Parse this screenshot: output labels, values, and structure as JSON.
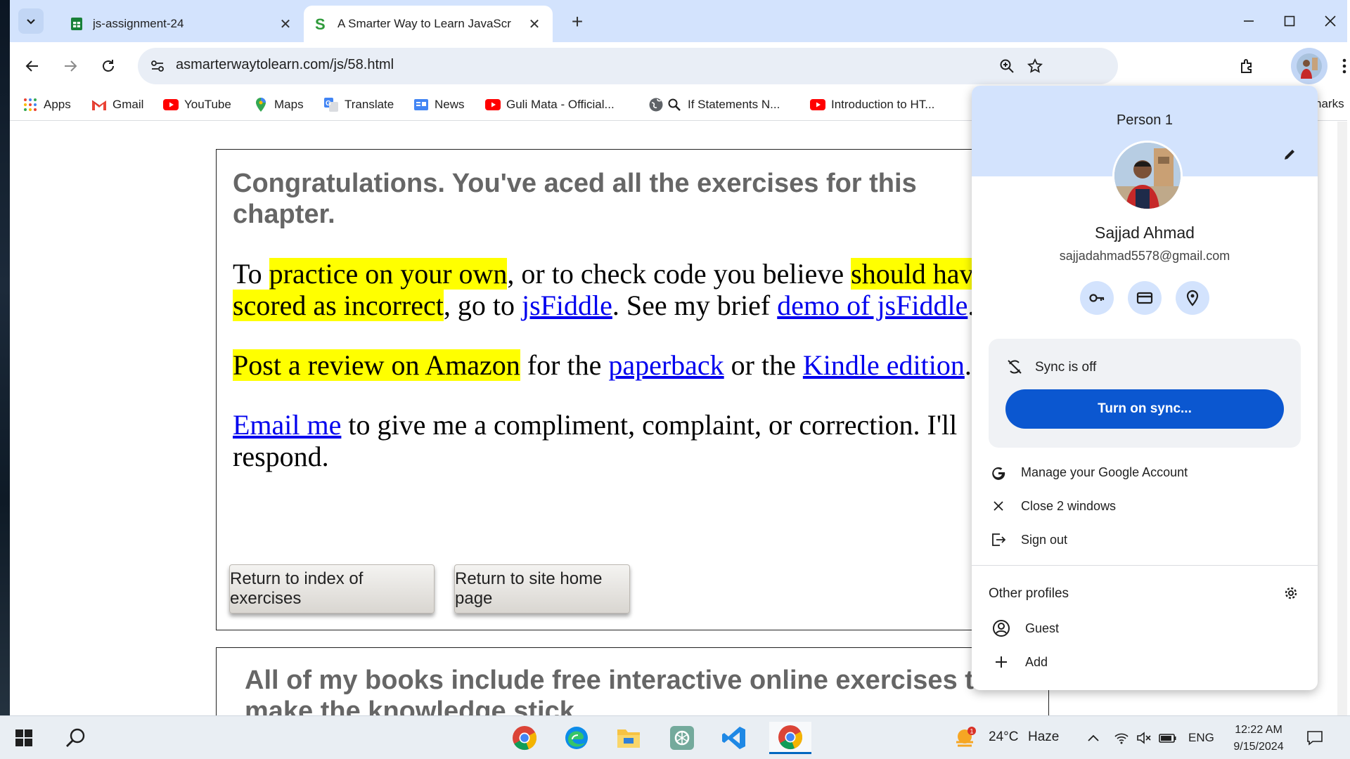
{
  "browser": {
    "tabs": [
      {
        "title": "js-assignment-24",
        "active": false
      },
      {
        "title": "A Smarter Way to Learn JavaScr",
        "active": true
      }
    ],
    "url": "asmarterwaytolearn.com/js/58.html"
  },
  "bookmarks": [
    {
      "label": "Apps",
      "icon": "apps-grid-icon"
    },
    {
      "label": "Gmail",
      "icon": "gmail-icon"
    },
    {
      "label": "YouTube",
      "icon": "youtube-icon"
    },
    {
      "label": "Maps",
      "icon": "maps-pin-icon"
    },
    {
      "label": "Translate",
      "icon": "translate-icon"
    },
    {
      "label": "News",
      "icon": "news-icon"
    },
    {
      "label": "Guli Mata - Official...",
      "icon": "youtube-icon"
    },
    {
      "label": "If Statements N...",
      "icon": "search-icon"
    },
    {
      "label": "Introduction to HT...",
      "icon": "youtube-icon"
    }
  ],
  "bookmarks_tail": "narks",
  "page": {
    "heading": "Congratulations. You've aced all the exercises for this chapter.",
    "p1": {
      "hl1": "practice on your own",
      "t1": ", or to check code you believe ",
      "hl2": "should have been scored as incorrect",
      "t2": ", go to ",
      "link1": "jsFiddle",
      "t3": ". See my brief ",
      "link2": "demo of jsFiddle",
      "t4": ".",
      "t0": "To "
    },
    "p2": {
      "hl": "Post a review on Amazon",
      "t1": " for the ",
      "link1": "paperback",
      "t2": " or the ",
      "link2": "Kindle edition",
      "t3": "."
    },
    "p3": {
      "link": "Email me",
      "t1": " to give me a compliment, complaint, or correction. I'll respond."
    },
    "btn_index": "Return to index of exercises",
    "btn_home": "Return to site home page",
    "heading2": "All of my books include free interactive online exercises that make the knowledge stick."
  },
  "profile_menu": {
    "header": "Person 1",
    "name": "Sajjad Ahmad",
    "email": "sajjadahmad5578@gmail.com",
    "sync_status": "Sync is off",
    "sync_button": "Turn on sync...",
    "items": [
      "Manage your Google Account",
      "Close 2 windows",
      "Sign out"
    ],
    "other_profiles_title": "Other profiles",
    "other_profiles": [
      "Guest",
      "Add"
    ]
  },
  "taskbar": {
    "weather_temp": "24°C",
    "weather_text": "Haze",
    "weather_badge": "1",
    "language": "ENG",
    "time": "12:22 AM",
    "date": "9/15/2024"
  },
  "colors": {
    "tabstrip": "#d3e3fd",
    "highlight": "#ffff00",
    "link": "#0000ee",
    "sync_button": "#0b57d0"
  }
}
